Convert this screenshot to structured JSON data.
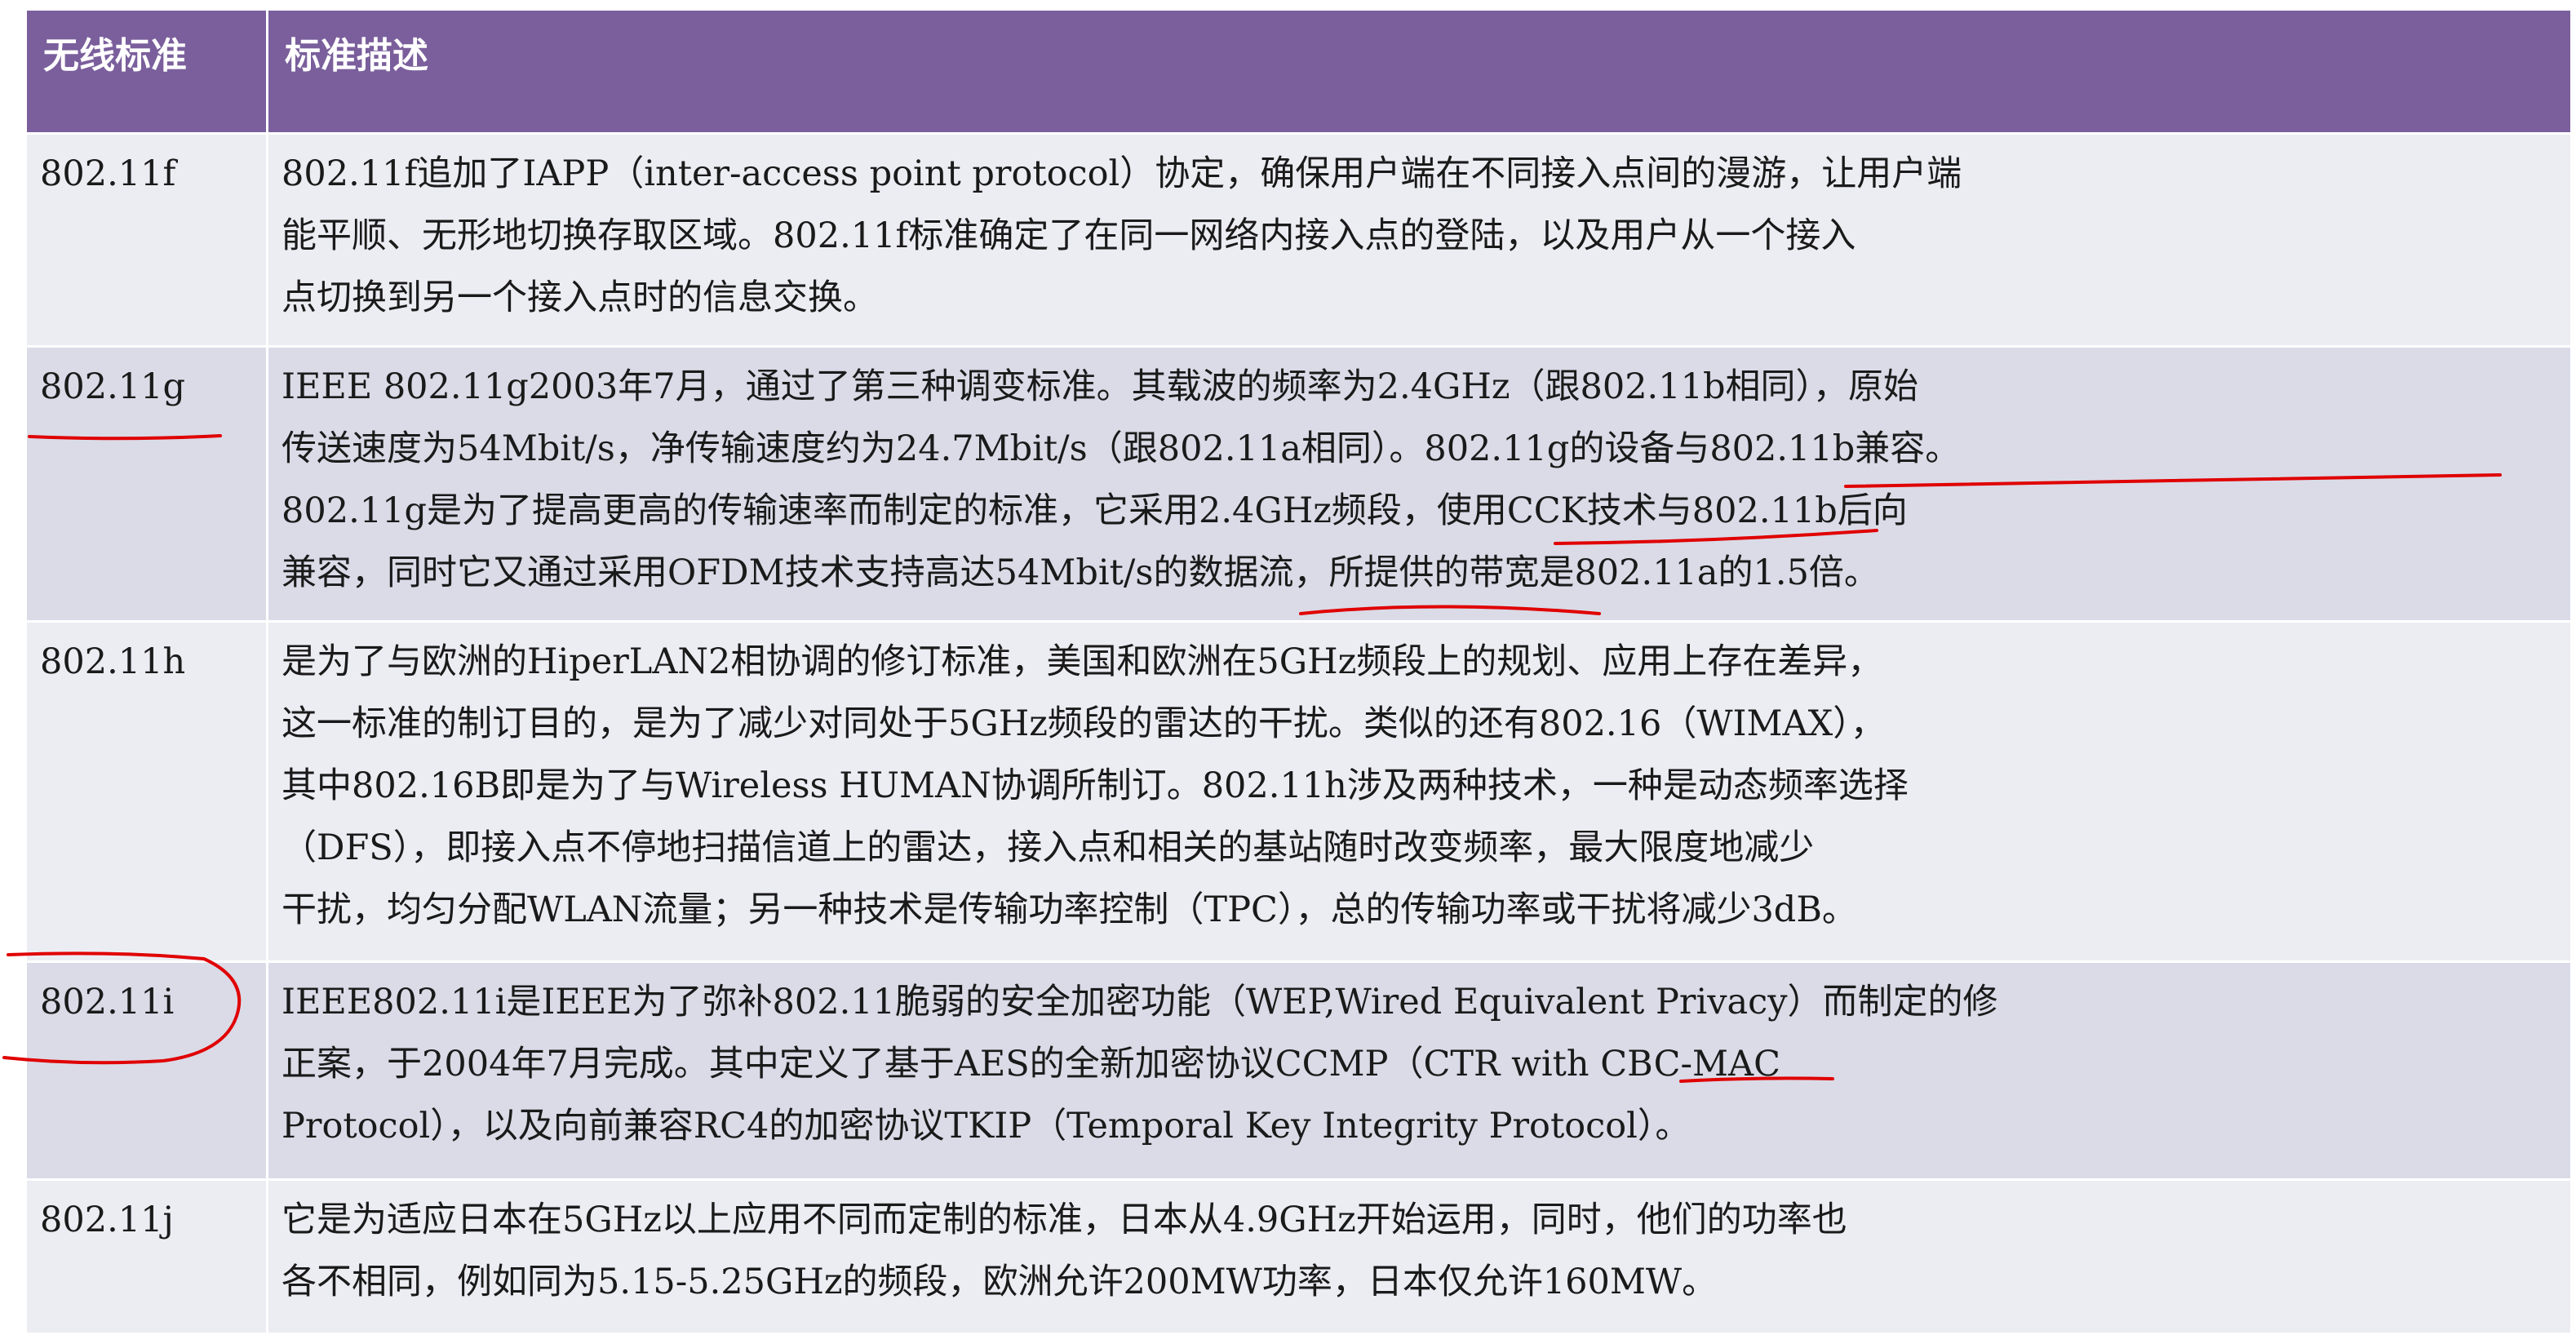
{
  "table": {
    "headers": {
      "standard": "无线标准",
      "description": "标准描述"
    },
    "rows": [
      {
        "standard": "802.11f",
        "description": "802.11f追加了IAPP（inter-access point protocol）协定，确保用户端在不同接入点间的漫游，让用户端\n能平顺、无形地切换存取区域。802.11f标准确定了在同一网络内接入点的登陆，以及用户从一个接入\n点切换到另一个接入点时的信息交换。"
      },
      {
        "standard": "802.11g",
        "description": "IEEE 802.11g2003年7月，通过了第三种调变标准。其载波的频率为2.4GHz（跟802.11b相同），原始\n传送速度为54Mbit/s，净传输速度约为24.7Mbit/s（跟802.11a相同）。802.11g的设备与802.11b兼容。\n802.11g是为了提高更高的传输速率而制定的标准，它采用2.4GHz频段，使用CCK技术与802.11b后向\n兼容，同时它又通过采用OFDM技术支持高达54Mbit/s的数据流，所提供的带宽是802.11a的1.5倍。"
      },
      {
        "standard": "802.11h",
        "description": "是为了与欧洲的HiperLAN2相协调的修订标准，美国和欧洲在5GHz频段上的规划、应用上存在差异，\n这一标准的制订目的，是为了减少对同处于5GHz频段的雷达的干扰。类似的还有802.16（WIMAX），\n其中802.16B即是为了与Wireless HUMAN协调所制订。802.11h涉及两种技术，一种是动态频率选择\n（DFS），即接入点不停地扫描信道上的雷达，接入点和相关的基站随时改变频率，最大限度地减少\n干扰，均匀分配WLAN流量；另一种技术是传输功率控制（TPC），总的传输功率或干扰将减少3dB。"
      },
      {
        "standard": "802.11i",
        "description": "IEEE802.11i是IEEE为了弥补802.11脆弱的安全加密功能（WEP,Wired Equivalent Privacy）而制定的修\n正案，于2004年7月完成。其中定义了基于AES的全新加密协议CCMP（CTR with CBC-MAC\nProtocol），以及向前兼容RC4的加密协议TKIP（Temporal Key Integrity Protocol）。"
      },
      {
        "standard": "802.11j",
        "description": "它是为适应日本在5GHz以上应用不同而定制的标准，日本从4.9GHz开始运用，同时，他们的功率也\n各不相同，例如同为5.15-5.25GHz的频段，欧洲允许200MW功率，日本仅允许160MW。"
      }
    ]
  },
  "colors": {
    "header_bg": "#7a5f9c",
    "row_light": "#ececf3",
    "row_dark": "#dadbe7",
    "annotation": "#e00000"
  }
}
